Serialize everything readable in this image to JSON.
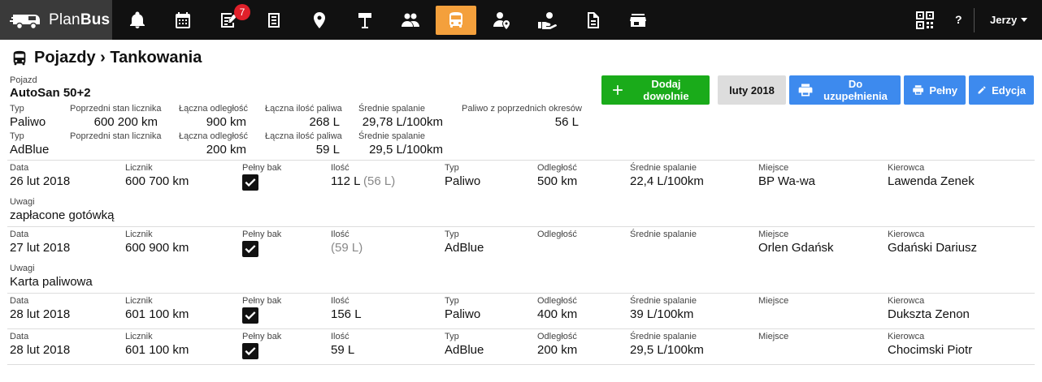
{
  "brand": {
    "name_regular": "Plan",
    "name_bold": "Bus"
  },
  "nav": {
    "notifications_badge": "7",
    "help": "?",
    "user": "Jerzy"
  },
  "page": {
    "title": "Pojazdy › Tankowania"
  },
  "vehicle": {
    "label": "Pojazd",
    "name": "AutoSan 50+2"
  },
  "summary_labels": {
    "type": "Typ",
    "prev_odometer": "Poprzedni stan licznika",
    "total_distance": "Łączna odległość",
    "total_fuel": "Łączna ilość paliwa",
    "avg_consumption": "Średnie spalanie",
    "prev_periods_fuel": "Paliwo z poprzednich okresów"
  },
  "summary": [
    {
      "type": "Paliwo",
      "prev_odometer": "600 200 km",
      "total_distance": "900 km",
      "total_fuel": "268 L",
      "avg_consumption": "29,78 L/100km",
      "prev_periods_fuel": "56 L"
    },
    {
      "type": "AdBlue",
      "prev_odometer": "",
      "total_distance": "200 km",
      "total_fuel": "59 L",
      "avg_consumption": "29,5 L/100km"
    }
  ],
  "buttons": {
    "add": "Dodaj dowolnie",
    "period": "luty 2018",
    "to_fill": "Do uzupełnienia",
    "full": "Pełny",
    "edit": "Edycja"
  },
  "entry_labels": {
    "date": "Data",
    "odometer": "Licznik",
    "full_tank": "Pełny bak",
    "amount": "Ilość",
    "type": "Typ",
    "distance": "Odległość",
    "avg": "Średnie spalanie",
    "place": "Miejsce",
    "driver": "Kierowca",
    "notes": "Uwagi"
  },
  "entries": [
    {
      "date": "26 lut 2018",
      "odometer": "600 700 km",
      "full_tank": true,
      "amount": "112 L",
      "amount_extra": "(56 L)",
      "type": "Paliwo",
      "distance": "500 km",
      "avg": "22,4 L/100km",
      "place": "BP Wa-wa",
      "driver": "Lawenda Zenek",
      "notes": "zapłacone gotówką"
    },
    {
      "date": "27 lut 2018",
      "odometer": "600 900 km",
      "full_tank": true,
      "amount": "",
      "amount_extra": "(59 L)",
      "type": "AdBlue",
      "distance": "",
      "avg": "",
      "place": "Orlen Gdańsk",
      "driver": "Gdański Dariusz",
      "notes": "Karta paliwowa"
    },
    {
      "date": "28 lut 2018",
      "odometer": "601 100 km",
      "full_tank": true,
      "amount": "156 L",
      "amount_extra": "",
      "type": "Paliwo",
      "distance": "400 km",
      "avg": "39 L/100km",
      "place": "",
      "driver": "Dukszta Zenon",
      "notes": ""
    },
    {
      "date": "28 lut 2018",
      "odometer": "601 100 km",
      "full_tank": true,
      "amount": "59 L",
      "amount_extra": "",
      "type": "AdBlue",
      "distance": "200 km",
      "avg": "29,5 L/100km",
      "place": "",
      "driver": "Chocimski Piotr",
      "notes": ""
    }
  ]
}
